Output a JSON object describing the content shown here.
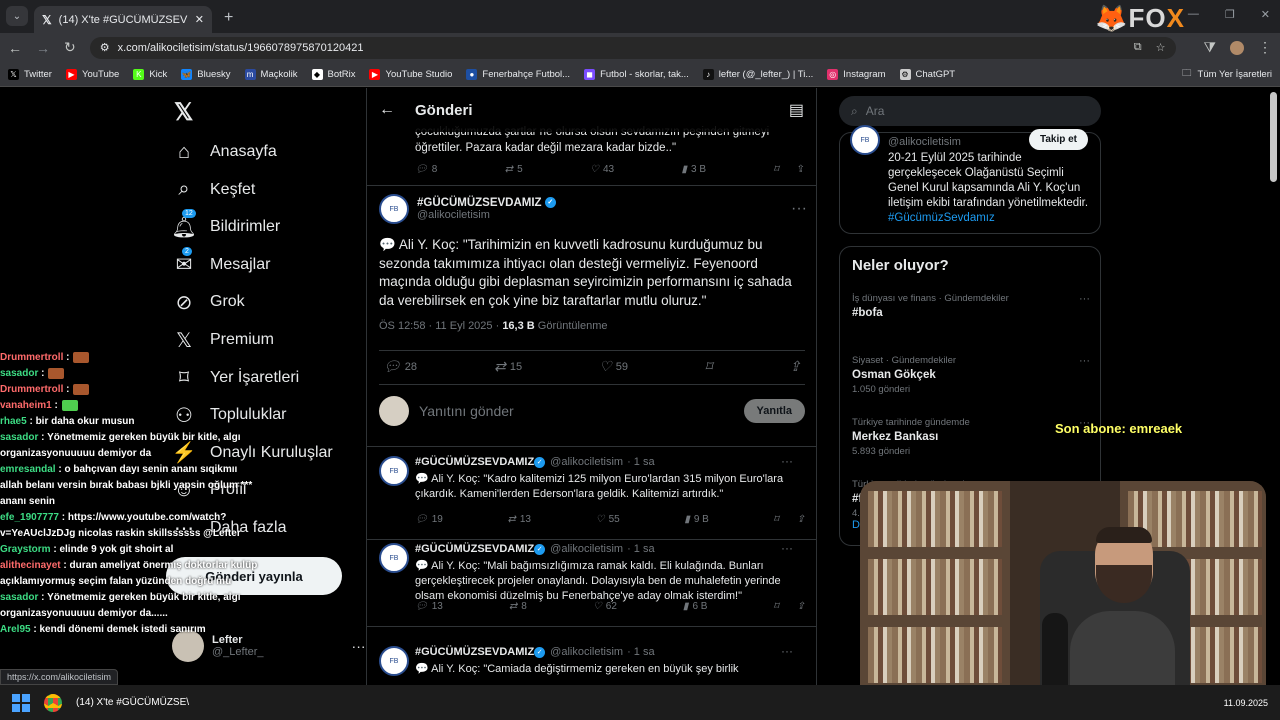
{
  "browser": {
    "tab_title": "(14) X'te #GÜCÜMÜZSEVDAMIZ",
    "url": "x.com/alikociletisim/status/1966078975870120421",
    "brand_prefix": "FO",
    "brand_suffix": "X",
    "url_hint": "https://x.com/alikociletisim"
  },
  "bookmarks": [
    {
      "label": "Twitter",
      "icon": "x-icon",
      "color": "#000000"
    },
    {
      "label": "YouTube",
      "icon": "youtube-icon",
      "color": "#ff0000"
    },
    {
      "label": "Kick",
      "icon": "kick-icon",
      "color": "#53fc18"
    },
    {
      "label": "Bluesky",
      "icon": "bluesky-icon",
      "color": "#1185fe"
    },
    {
      "label": "Maçkolik",
      "icon": "mackolik-icon",
      "color": "#2b4aa0"
    },
    {
      "label": "BotRix",
      "icon": "botrix-icon",
      "color": "#ffffff"
    },
    {
      "label": "YouTube Studio",
      "icon": "youtube-studio-icon",
      "color": "#ff0000"
    },
    {
      "label": "Fenerbahçe Futbol...",
      "icon": "fenerbahce-icon",
      "color": "#1d4fa3"
    },
    {
      "label": "Futbol - skorlar, tak...",
      "icon": "flashscore-icon",
      "color": "#7a4cff"
    },
    {
      "label": "lefter (@_lefter_) | Ti...",
      "icon": "tiktok-icon",
      "color": "#111111"
    },
    {
      "label": "Instagram",
      "icon": "instagram-icon",
      "color": "#e1306c"
    },
    {
      "label": "ChatGPT",
      "icon": "chatgpt-icon",
      "color": "#cccccc"
    }
  ],
  "bookmarks_folder": "Tüm Yer İşaretleri",
  "nav": {
    "items": [
      {
        "label": "Anasayfa",
        "icon": "home-icon"
      },
      {
        "label": "Keşfet",
        "icon": "search-icon"
      },
      {
        "label": "Bildirimler",
        "icon": "bell-icon",
        "badge": "12"
      },
      {
        "label": "Mesajlar",
        "icon": "mail-icon",
        "badge": "2"
      },
      {
        "label": "Grok",
        "icon": "grok-icon"
      },
      {
        "label": "Premium",
        "icon": "x-premium-icon"
      },
      {
        "label": "Yer İşaretleri",
        "icon": "bookmark-icon"
      },
      {
        "label": "Topluluklar",
        "icon": "communities-icon"
      },
      {
        "label": "Onaylı Kuruluşlar",
        "icon": "verified-orgs-icon"
      },
      {
        "label": "Profil",
        "icon": "profile-icon"
      },
      {
        "label": "Daha fazla",
        "icon": "more-icon"
      }
    ],
    "post_button": "Gönderi yayınla",
    "me_name": "Lefter",
    "me_handle": "@_Lefter_"
  },
  "chat": [
    {
      "user": "Drummertroll",
      "msg": ""
    },
    {
      "user": "sasador",
      "msg": ""
    },
    {
      "user": "Drummertroll",
      "msg": ""
    },
    {
      "user": "vanaheim1",
      "msg": ""
    },
    {
      "user": "rhae5",
      "msg": "bir daha okur musun"
    },
    {
      "user": "sasador",
      "msg": "Yönetmemiz gereken büyük bir kitle, algı organizasyonuuuuu demiyor da"
    },
    {
      "user": "emresandal",
      "msg": "o bahçıvan dayı senin ananı sıqikmıı allah belanı versin bırak babası bjkli yapsin oğlum *** ananı senin"
    },
    {
      "user": "efe_1907777",
      "msg": "https://www.youtube.com/watch?v=YeAUclJzDJg nicolas raskin skillssssss @Lefter"
    },
    {
      "user": "Graystorm",
      "msg": "elinde 9 yok git shoirt al"
    },
    {
      "user": "alithecinayet",
      "msg": "duran ameliyat önermiş doktorlar kulüp açıklamıyormuş seçim falan yüzünden doğru mu"
    },
    {
      "user": "sasador",
      "msg": "Yönetmemiz gereken büyük bir kitle, algı organizasyonuuuuu demiyor da......"
    },
    {
      "user": "Arel95",
      "msg": "kendi dönemi demek istedi sanırım"
    }
  ],
  "main": {
    "title": "Gönderi",
    "quote_tail": "çocukluğumuzda şartlar ne olursa olsun sevdamızın peşinden gitmeyi öğrettiler. Pazara kadar değil mezara kadar bizde..\"",
    "quote_actions": {
      "replies": "8",
      "reposts": "5",
      "likes": "43",
      "views": "3 B"
    },
    "focus": {
      "name": "#GÜCÜMÜZSEVDAMIZ",
      "handle": "@alikociletisim",
      "text": "💬 Ali Y. Koç: \"Tarihimizin en kuvvetli kadrosunu kurduğumuz bu sezonda takımımıza ihtiyacı olan desteği vermeliyiz. Feyenoord maçında olduğu gibi deplasman seyircimizin performansını iç sahada da verebilirsek en çok yine biz taraftarlar mutlu oluruz.\"",
      "time": "ÖS 12:58 · 11 Eyl 2025 · ",
      "views": "16,3 B",
      "views_label": " Görüntülenme",
      "replies": "28",
      "reposts": "15",
      "likes": "59"
    },
    "reply_placeholder": "Yanıtını gönder",
    "reply_button": "Yanıtla",
    "tweets": [
      {
        "name": "#GÜCÜMÜZSEVDAMIZ",
        "handle": "@alikociletisim",
        "time": "· 1 sa",
        "text": "💬 Ali Y. Koç: \"Kadro kalitemizi 125 milyon Euro'lardan 315 milyon Euro'lara çıkardık. Kameni'lerden Ederson'lara geldik. Kalitemizi artırdık.\"",
        "replies": "19",
        "reposts": "13",
        "likes": "55",
        "views": "9 B"
      },
      {
        "name": "#GÜCÜMÜZSEVDAMIZ",
        "handle": "@alikociletisim",
        "time": "· 1 sa",
        "text": "💬 Ali Y. Koç: \"Mali bağımsızlığımıza ramak kaldı. Eli kulağında. Bunları gerçekleştirecek projeler onaylandı. Dolayısıyla ben de muhalefetin yerinde olsam ekonomisi düzelmiş bu Fenerbahçe'ye aday olmak isterdim!\"",
        "replies": "13",
        "reposts": "8",
        "likes": "62",
        "views": "6 B"
      },
      {
        "name": "#GÜCÜMÜZSEVDAMIZ",
        "handle": "@alikociletisim",
        "time": "· 1 sa",
        "text": "💬 Ali Y. Koç: \"Camiada değiştirmemiz gereken en büyük şey birlik",
        "replies": "",
        "reposts": "",
        "likes": "",
        "views": ""
      }
    ]
  },
  "right": {
    "search_placeholder": "Ara",
    "profile_card": {
      "handle": "@alikociletisim",
      "follow": "Takip et",
      "bio": "20-21 Eylül 2025 tarihinde gerçekleşecek Olağanüstü Seçimli Genel Kurul kapsamında Ali Y. Koç'un iletişim ekibi tarafından yönetilmektedir. ",
      "bio_tag": "#GücümüzSevdamız"
    },
    "trends_title": "Neler oluyor?",
    "trends": [
      {
        "context": "İş dünyası ve finans · Gündemdekiler",
        "name": "#bofa",
        "count": ""
      },
      {
        "context": "Siyaset · Gündemdekiler",
        "name": "Osman Gökçek",
        "count": "1.050 gönderi"
      },
      {
        "context": "Türkiye tarihinde gündemde",
        "name": "Merkez Bankası",
        "count": "5.893 gönderi"
      },
      {
        "context": "Türkiye tarihinde gündemde",
        "name": "#fai",
        "count": "4..."
      }
    ],
    "show_more": "Da"
  },
  "overlay": {
    "last_sub": "Son abone: emreaek"
  },
  "taskbar": {
    "chrome_title": "(14) X'te #GÜCÜMÜZSE\\",
    "date": "11.09.2025"
  }
}
